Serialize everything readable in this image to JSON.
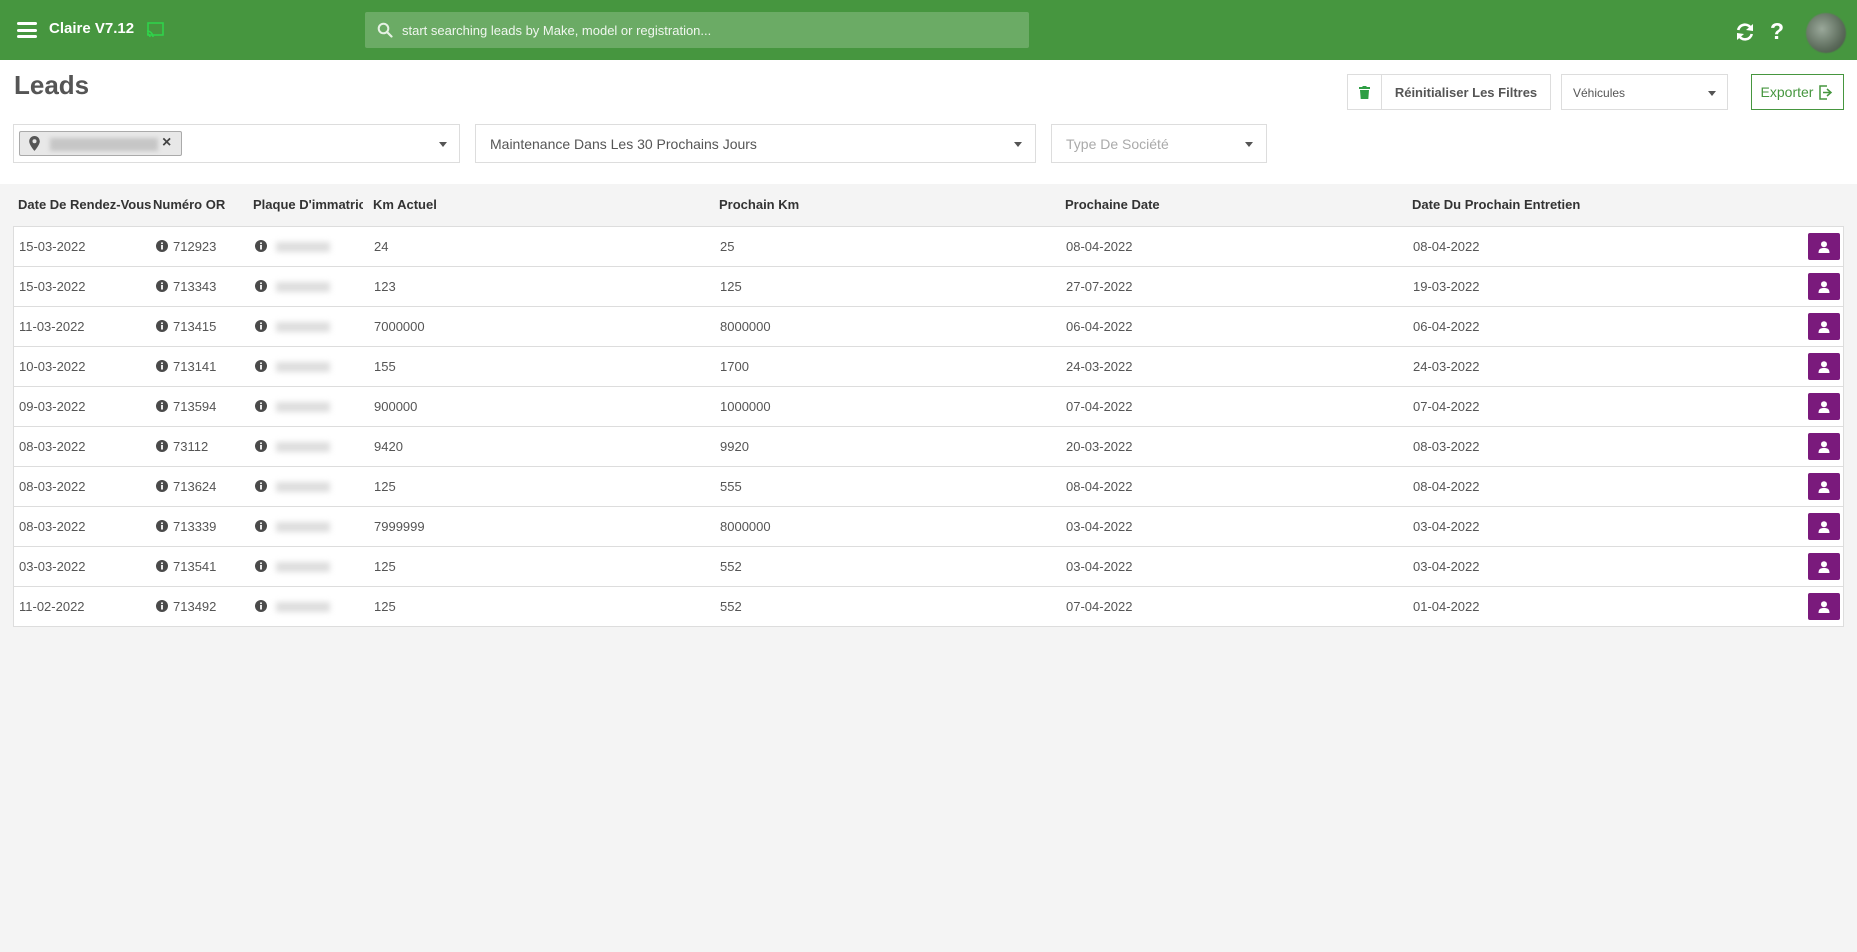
{
  "app": {
    "title": "Claire V7.12"
  },
  "search": {
    "placeholder": "start searching leads by Make, model or registration..."
  },
  "page": {
    "title": "Leads"
  },
  "toolbar": {
    "reset_label": "Réinitialiser Les Filtres",
    "vehicles_label": "Véhicules",
    "export_label": "Exporter"
  },
  "filters": {
    "maintenance": "Maintenance Dans Les 30 Prochains Jours",
    "company_type_placeholder": "Type De Société"
  },
  "table": {
    "headers": [
      "Date De Rendez-Vous",
      "Numéro OR",
      "Plaque D'immatricu",
      "Km Actuel",
      "Prochain Km",
      "Prochaine Date",
      "Date Du Prochain Entretien"
    ],
    "rows": [
      {
        "date": "15-03-2022",
        "or": "712923",
        "km": "24",
        "next_km": "25",
        "next_date": "08-04-2022",
        "next_service": "08-04-2022"
      },
      {
        "date": "15-03-2022",
        "or": "713343",
        "km": "123",
        "next_km": "125",
        "next_date": "27-07-2022",
        "next_service": "19-03-2022"
      },
      {
        "date": "11-03-2022",
        "or": "713415",
        "km": "7000000",
        "next_km": "8000000",
        "next_date": "06-04-2022",
        "next_service": "06-04-2022"
      },
      {
        "date": "10-03-2022",
        "or": "713141",
        "km": "155",
        "next_km": "1700",
        "next_date": "24-03-2022",
        "next_service": "24-03-2022"
      },
      {
        "date": "09-03-2022",
        "or": "713594",
        "km": "900000",
        "next_km": "1000000",
        "next_date": "07-04-2022",
        "next_service": "07-04-2022"
      },
      {
        "date": "08-03-2022",
        "or": "73112",
        "km": "9420",
        "next_km": "9920",
        "next_date": "20-03-2022",
        "next_service": "08-03-2022"
      },
      {
        "date": "08-03-2022",
        "or": "713624",
        "km": "125",
        "next_km": "555",
        "next_date": "08-04-2022",
        "next_service": "08-04-2022"
      },
      {
        "date": "08-03-2022",
        "or": "713339",
        "km": "7999999",
        "next_km": "8000000",
        "next_date": "03-04-2022",
        "next_service": "03-04-2022"
      },
      {
        "date": "03-03-2022",
        "or": "713541",
        "km": "125",
        "next_km": "552",
        "next_date": "03-04-2022",
        "next_service": "03-04-2022"
      },
      {
        "date": "11-02-2022",
        "or": "713492",
        "km": "125",
        "next_km": "552",
        "next_date": "07-04-2022",
        "next_service": "01-04-2022"
      }
    ]
  },
  "colors": {
    "topbar": "#46963f",
    "accent": "#46963f",
    "action_button": "#7a1a7c",
    "trash": "#2e9e44"
  },
  "icons": {
    "menu": "hamburger-icon",
    "cast": "cast-icon",
    "search": "search-icon",
    "refresh": "refresh-icon",
    "help": "help-icon",
    "trash": "trash-icon",
    "export": "export-icon",
    "pin": "map-pin-icon",
    "info": "info-icon",
    "user": "user-icon"
  }
}
